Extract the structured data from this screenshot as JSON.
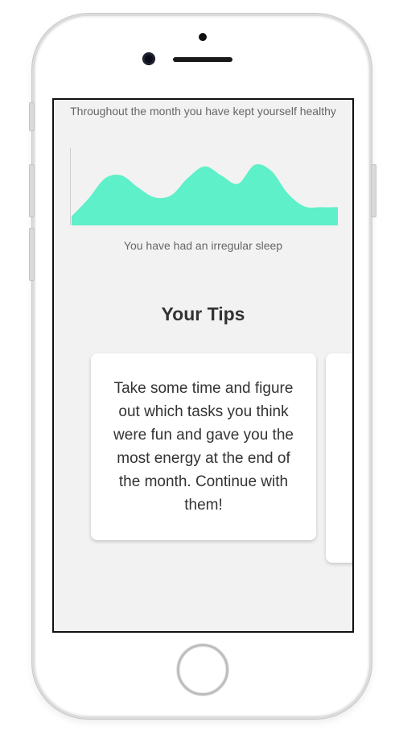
{
  "screen": {
    "summary_text": "Throughout the month you have kept yourself healthy",
    "sleep_text": "You have had an irregular sleep",
    "tips_title": "Your Tips",
    "tips": [
      {
        "text": "Take some time and figure out which tasks you think were fun and gave you the most energy at the end of the month. Continue with them!"
      }
    ]
  },
  "chart_data": {
    "type": "area",
    "title": "",
    "xlabel": "",
    "ylabel": "",
    "color": "#5ef0c8",
    "x": [
      0,
      1,
      2,
      3,
      4,
      5,
      6,
      7,
      8,
      9,
      10,
      11,
      12,
      13,
      14,
      15,
      16
    ],
    "values": [
      0.12,
      0.35,
      0.62,
      0.66,
      0.5,
      0.37,
      0.4,
      0.63,
      0.78,
      0.66,
      0.55,
      0.8,
      0.72,
      0.42,
      0.25,
      0.24,
      0.24
    ],
    "ylim": [
      0,
      1
    ],
    "grid": false
  }
}
